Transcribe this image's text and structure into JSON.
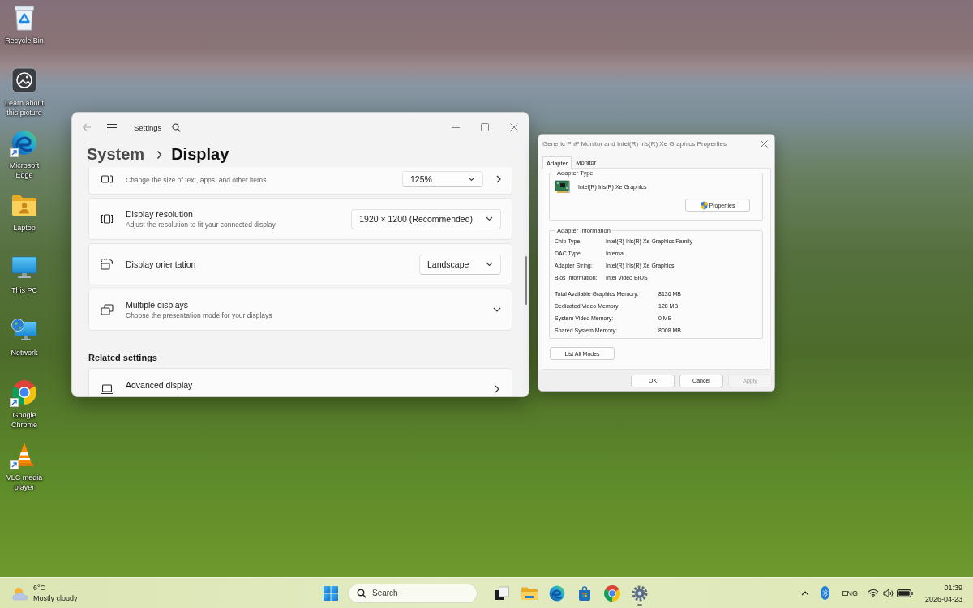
{
  "desktop_icons": [
    {
      "label": "Recycle Bin",
      "shortcut": false
    },
    {
      "label": "Learn about this picture",
      "shortcut": false
    },
    {
      "label": "Microsoft Edge",
      "shortcut": true
    },
    {
      "label": "Laptop",
      "shortcut": false
    },
    {
      "label": "This PC",
      "shortcut": false
    },
    {
      "label": "Network",
      "shortcut": false
    },
    {
      "label": "Google Chrome",
      "shortcut": true
    },
    {
      "label": "VLC media player",
      "shortcut": true
    }
  ],
  "settings_window": {
    "back_button": {
      "disabled": true
    },
    "app_title": "Settings",
    "breadcrumb": {
      "parent": "System",
      "current": "Display"
    },
    "cards": [
      {
        "kind": "dropdownlink",
        "description": "Change the size of text, apps, and other items",
        "value": "125%"
      },
      {
        "kind": "dropdown",
        "title": "Display resolution",
        "description": "Adjust the resolution to fit your connected display",
        "value": "1920 × 1200 (Recommended)"
      },
      {
        "kind": "dropdown",
        "title": "Display orientation",
        "value": "Landscape"
      },
      {
        "kind": "expander",
        "title": "Multiple displays",
        "description": "Choose the presentation mode for your displays",
        "expanded": false
      }
    ],
    "section_heading": "Related settings",
    "related_cards": [
      {
        "kind": "link",
        "title": "Advanced display"
      }
    ]
  },
  "properties_dialog": {
    "title": "Generic PnP Monitor and Intel(R) Iris(R) Xe Graphics Properties",
    "tabs": [
      {
        "label": "Adapter",
        "selected": true
      },
      {
        "label": "Monitor",
        "selected": false
      }
    ],
    "adapter_type": {
      "heading": "Adapter Type",
      "name": "Intel(R) Iris(R) Xe Graphics",
      "button": "Properties"
    },
    "adapter_information": {
      "heading": "Adapter Information",
      "details": [
        {
          "label": "Chip Type:",
          "value": "Intel(R) Iris(R) Xe Graphics Family"
        },
        {
          "label": "DAC Type:",
          "value": "Internal"
        },
        {
          "label": "Adapter String:",
          "value": "Intel(R) Iris(R) Xe Graphics"
        },
        {
          "label": "Bios Information:",
          "value": "Intel Video BIOS"
        }
      ],
      "memory": [
        {
          "label": "Total Available Graphics Memory:",
          "value": "8136 MB"
        },
        {
          "label": "Dedicated Video Memory:",
          "value": "128 MB"
        },
        {
          "label": "System Video Memory:",
          "value": "0 MB"
        },
        {
          "label": "Shared System Memory:",
          "value": "8008 MB"
        }
      ]
    },
    "list_modes_button": "List All Modes",
    "buttons": [
      {
        "label": "OK",
        "disabled": false
      },
      {
        "label": "Cancel",
        "disabled": false
      },
      {
        "label": "Apply",
        "disabled": true
      }
    ]
  },
  "taskbar": {
    "weather": {
      "temperature": "6°C",
      "condition": "Mostly cloudy"
    },
    "search": {
      "placeholder": "Search"
    },
    "apps": [
      {
        "running": false
      },
      {
        "running": false
      },
      {
        "running": false
      },
      {
        "running": false
      },
      {
        "running": false
      },
      {
        "running": true
      }
    ],
    "tray": {
      "language": "ENG"
    },
    "clock": {
      "time": "01:39",
      "date": "2026-04-23"
    }
  }
}
